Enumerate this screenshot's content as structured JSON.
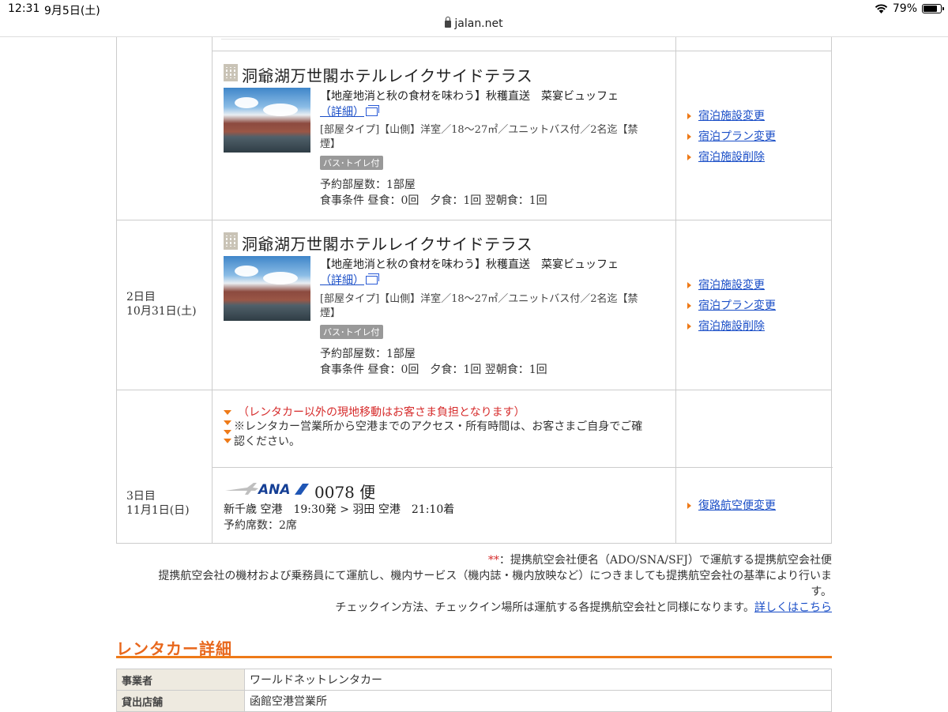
{
  "status": {
    "time": "12:31",
    "date": "9月5日(土)",
    "battery": "79%",
    "battery_level": 0.79
  },
  "browser": {
    "url": "jalan.net"
  },
  "itinerary": {
    "hotel1": {
      "name": "洞爺湖万世閣ホテルレイクサイドテラス",
      "plan": "【地産地消と秋の食材を味わう】秋穫直送　菜宴ビュッフェ",
      "detail_link": "（詳細）",
      "room_type_line1": "[部屋タイプ]【山側】洋室／18〜27㎡／ユニットバス付／2名迄【禁",
      "room_type_line2": "煙】",
      "badge": "バス･トイレ付",
      "rooms": "予約部屋数：1部屋",
      "meals": "食事条件 昼食：0回　夕食：1回 翌朝食：1回",
      "actions": [
        "宿泊施設変更",
        "宿泊プラン変更",
        "宿泊施設削除"
      ]
    },
    "day2": {
      "label": "2日目",
      "date": "10月31日(土)"
    },
    "hotel2": {
      "name": "洞爺湖万世閣ホテルレイクサイドテラス",
      "plan": "【地産地消と秋の食材を味わう】秋穫直送　菜宴ビュッフェ",
      "detail_link": "（詳細）",
      "room_type_line1": "[部屋タイプ]【山側】洋室／18〜27㎡／ユニットバス付／2名迄【禁",
      "room_type_line2": "煙】",
      "badge": "バス･トイレ付",
      "rooms": "予約部屋数：1部屋",
      "meals": "食事条件 昼食：0回　夕食：1回 翌朝食：1回",
      "actions": [
        "宿泊施設変更",
        "宿泊プラン変更",
        "宿泊施設削除"
      ]
    },
    "day3": {
      "label": "3日目",
      "date": "11月1日(日)"
    },
    "notice": {
      "red": "（レンタカー以外の現地移動はお客さま負担となります）",
      "line1": "※レンタカー営業所から空港までのアクセス・所有時間は、お客さまご自身でご確",
      "line2": "認ください。"
    },
    "flight": {
      "airline": "ANA",
      "number": "0078 便",
      "route": "新千歳 空港　19:30発 > 羽田 空港　21:10着",
      "seats": "予約席数：2席",
      "action": "復路航空便変更"
    }
  },
  "notes": {
    "mark": "**",
    "line1": "：提携航空会社便名（ADO/SNA/SFJ）で運航する提携航空会社便",
    "line2": "提携航空会社の機材および乗務員にて運航し、機内サービス（機内誌・機内放映など）につきましても提携航空会社の基準により行いま",
    "line3": "す。",
    "line4": "チェックイン方法、チェックイン場所は運航する各提携航空会社と同様になります。",
    "link": "詳しくはこちら"
  },
  "rental": {
    "title": "レンタカー詳細",
    "rows": [
      {
        "label": "事業者",
        "value": "ワールドネットレンタカー"
      },
      {
        "label": "貸出店舗",
        "value": "函館空港営業所"
      }
    ]
  },
  "colors": {
    "accent": "#ee7a18",
    "link": "#1a4ec7",
    "alert": "#d62b2b"
  }
}
